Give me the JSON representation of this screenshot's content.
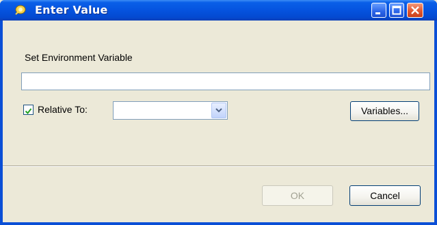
{
  "window": {
    "title": "Enter Value"
  },
  "form": {
    "prompt_label": "Set Environment Variable",
    "value": "",
    "relative_checked": true,
    "relative_label": "Relative To:",
    "relative_selected": ""
  },
  "buttons": {
    "variables": "Variables...",
    "ok": "OK",
    "cancel": "Cancel",
    "ok_enabled": false
  },
  "colors": {
    "titlebar": "#0553df",
    "client": "#ece9d8",
    "close": "#e2572f"
  }
}
